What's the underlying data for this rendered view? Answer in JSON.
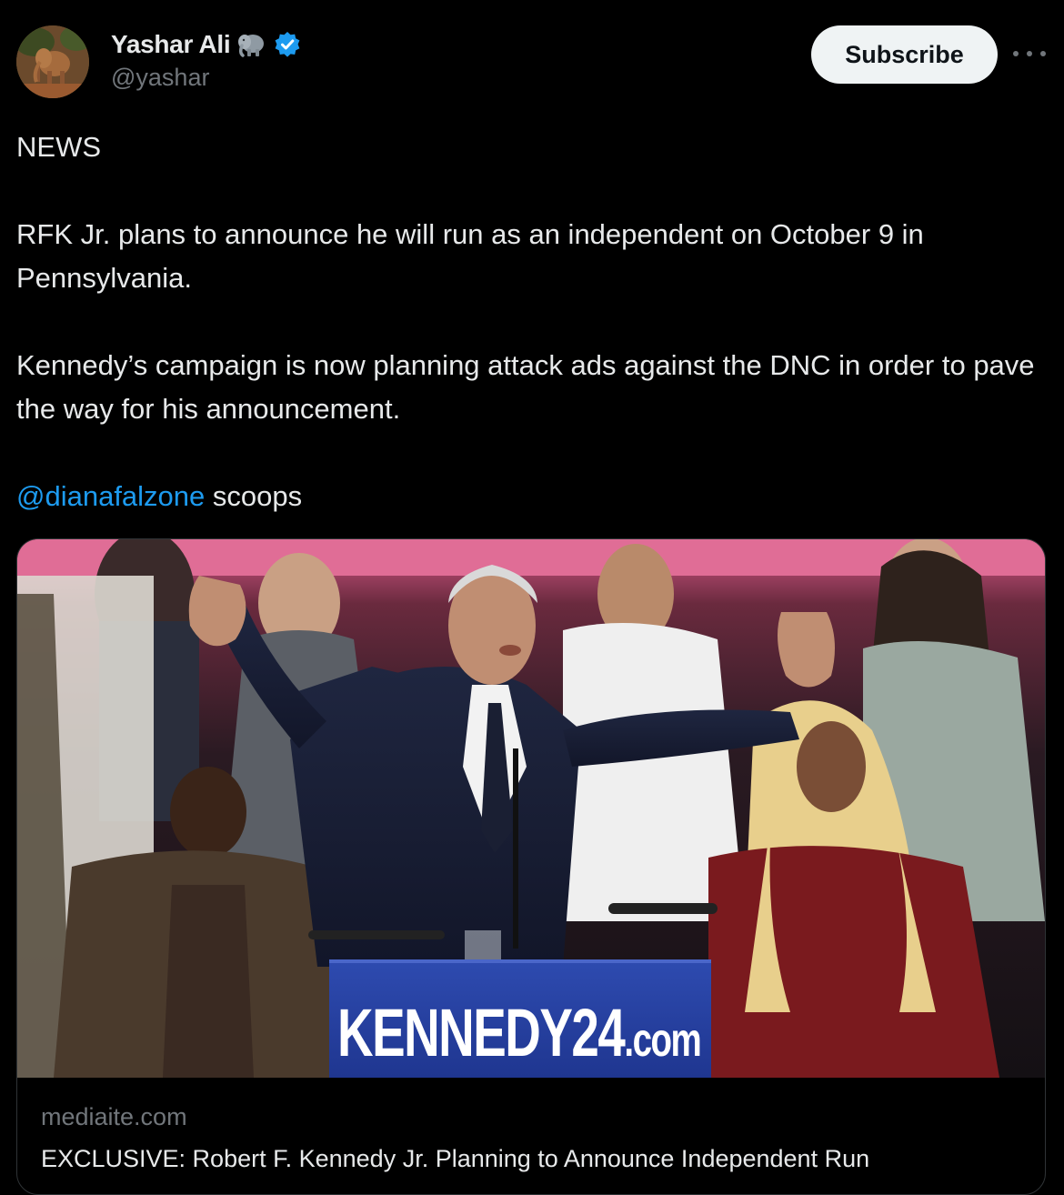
{
  "author": {
    "display_name": "Yashar Ali",
    "handle": "@yashar",
    "emoji_icon": "elephant-icon",
    "verified_icon": "verified-badge-icon"
  },
  "actions": {
    "subscribe_label": "Subscribe",
    "more_icon": "more-options-icon"
  },
  "tweet": {
    "line1": "NEWS",
    "line2": "RFK Jr. plans to announce he will run as an independent on October 9 in Pennsylvania.",
    "line3": "Kennedy’s campaign is now planning attack ads against the DNC in order to pave the way for his  announcement.",
    "mention": "@dianafalzone",
    "mention_suffix": " scoops"
  },
  "link_card": {
    "podium_text": "KENNEDY24",
    "podium_text_suffix": ".com",
    "domain": "mediaite.com",
    "headline": "EXCLUSIVE: Robert F. Kennedy Jr. Planning to Announce Independent Run"
  },
  "colors": {
    "background": "#000000",
    "text": "#e7e9ea",
    "secondary": "#71767b",
    "link": "#1d9bf0",
    "verified": "#1d9bf0",
    "button_bg": "#eff3f4"
  }
}
